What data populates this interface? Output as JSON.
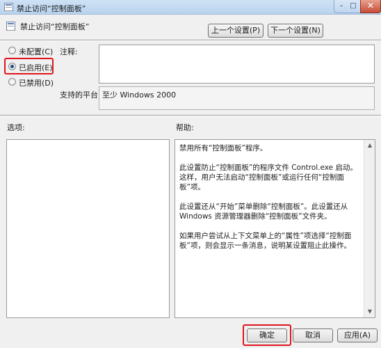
{
  "window": {
    "title": "禁止访问“控制面板”",
    "minimize": "–",
    "maximize": "□",
    "close": "✕"
  },
  "header": {
    "policy_name": "禁止访问“控制面板”",
    "prev_button": "上一个设置(P)",
    "next_button": "下一个设置(N)"
  },
  "state_options": [
    {
      "label": "未配置(C)",
      "checked": false
    },
    {
      "label": "已启用(E)",
      "checked": true
    },
    {
      "label": "已禁用(D)",
      "checked": false
    }
  ],
  "comment": {
    "label": "注释:",
    "value": ""
  },
  "platform": {
    "label": "支持的平台:",
    "value": "至少 Windows 2000"
  },
  "options_section": {
    "label": "选项:"
  },
  "help_section": {
    "label": "帮助:",
    "paragraphs": [
      "禁用所有“控制面板”程序。",
      "此设置防止“控制面板”的程序文件 Control.exe 启动。这样，用户无法启动“控制面板”或运行任何“控制面板”项。",
      "此设置还从“开始”菜单删除“控制面板”。此设置还从 Windows 资源管理器删除“控制面板”文件夹。",
      "如果用户尝试从上下文菜单上的“属性”项选择“控制面板”项，则会显示一条消息，说明某设置阻止此操作。"
    ]
  },
  "footer": {
    "ok": "确定",
    "cancel": "取消",
    "apply": "应用(A)"
  },
  "colors": {
    "highlight": "#e0141e",
    "accent": "#1c4a8a"
  }
}
